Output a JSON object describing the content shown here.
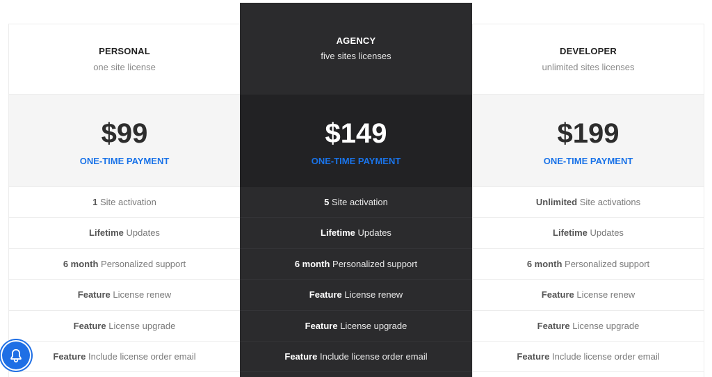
{
  "plans": [
    {
      "name": "PERSONAL",
      "subtitle": "one site license",
      "price": "$99",
      "payment": "ONE-TIME PAYMENT",
      "features": [
        {
          "bold": "1",
          "text": " Site activation"
        },
        {
          "bold": "Lifetime",
          "text": " Updates"
        },
        {
          "bold": "6 month",
          "text": " Personalized support"
        },
        {
          "bold": "Feature",
          "text": " License renew"
        },
        {
          "bold": "Feature",
          "text": " License upgrade"
        },
        {
          "bold": "Feature",
          "text": " Include license order email"
        }
      ]
    },
    {
      "name": "AGENCY",
      "subtitle": "five sites licenses",
      "price": "$149",
      "payment": "ONE-TIME PAYMENT",
      "features": [
        {
          "bold": "5",
          "text": " Site activation"
        },
        {
          "bold": "Lifetime",
          "text": " Updates"
        },
        {
          "bold": "6 month",
          "text": " Personalized support"
        },
        {
          "bold": "Feature",
          "text": " License renew"
        },
        {
          "bold": "Feature",
          "text": " License upgrade"
        },
        {
          "bold": "Feature",
          "text": " Include license order email"
        }
      ]
    },
    {
      "name": "DEVELOPER",
      "subtitle": "unlimited sites licenses",
      "price": "$199",
      "payment": "ONE-TIME PAYMENT",
      "features": [
        {
          "bold": "Unlimited",
          "text": " Site activations"
        },
        {
          "bold": "Lifetime",
          "text": " Updates"
        },
        {
          "bold": "6 month",
          "text": " Personalized support"
        },
        {
          "bold": "Feature",
          "text": " License renew"
        },
        {
          "bold": "Feature",
          "text": " License upgrade"
        },
        {
          "bold": "Feature",
          "text": " Include license order email"
        }
      ]
    }
  ],
  "colors": {
    "accent": "#1a73e8",
    "featured_bg": "#2b2b2d",
    "featured_price_bg": "#222224",
    "price_bg": "#f5f5f5"
  },
  "widgets": {
    "notification_icon": "bell-icon"
  }
}
